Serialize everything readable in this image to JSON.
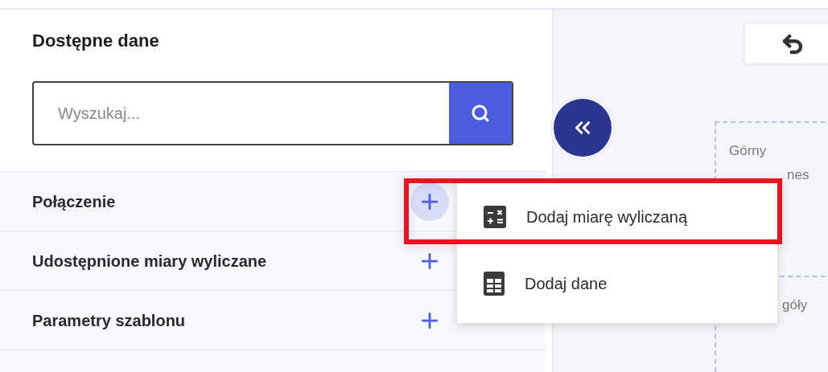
{
  "panel": {
    "title": "Dostępne dane",
    "search": {
      "placeholder": "Wyszukaj..."
    },
    "sections": [
      {
        "label": "Połączenie",
        "highlighted": true
      },
      {
        "label": "Udostępnione miary wyliczane",
        "highlighted": false
      },
      {
        "label": "Parametry szablonu",
        "highlighted": false
      }
    ]
  },
  "canvas": {
    "zones": [
      {
        "lines": [
          "Górny",
          "nes"
        ]
      },
      {
        "lines": [
          "góły"
        ]
      }
    ]
  },
  "menu": {
    "items": [
      {
        "label": "Dodaj miarę wyliczaną",
        "kind": "calculator",
        "highlighted": true
      },
      {
        "label": "Dodaj dane",
        "kind": "table",
        "highlighted": false
      }
    ]
  }
}
